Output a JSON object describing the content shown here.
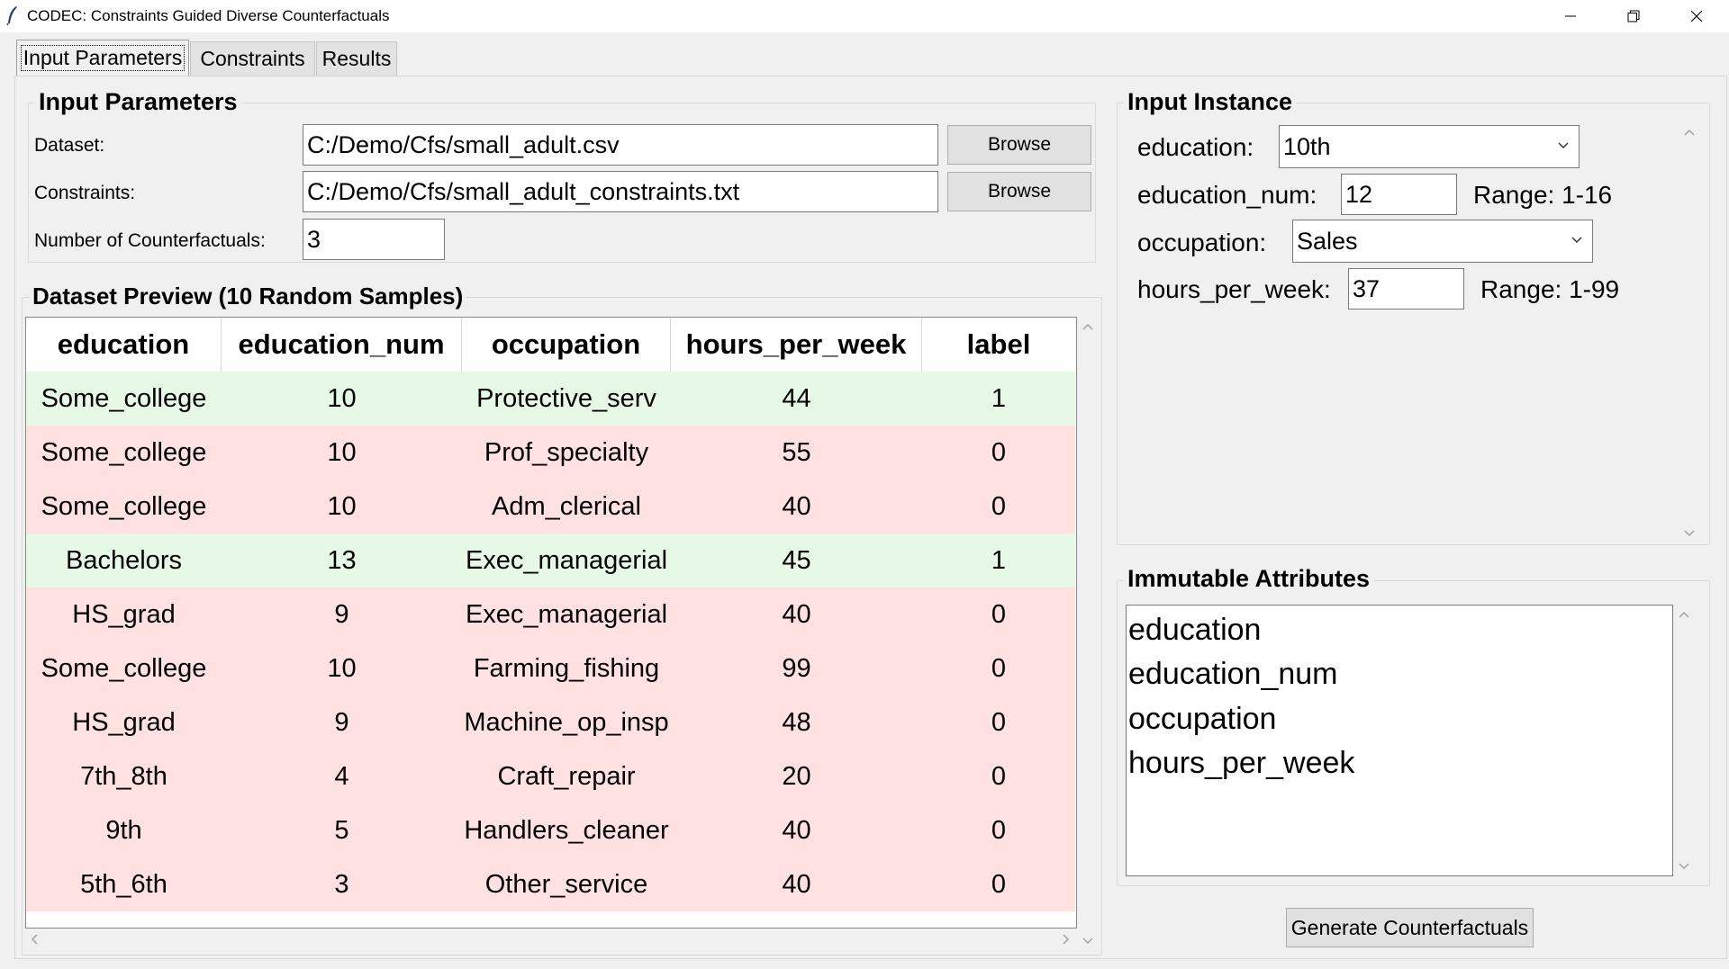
{
  "window": {
    "title": "CODEC: Constraints Guided Diverse Counterfactuals"
  },
  "tabs": [
    {
      "label": "Input Parameters"
    },
    {
      "label": "Constraints"
    },
    {
      "label": "Results"
    }
  ],
  "input_parameters": {
    "title": "Input Parameters",
    "dataset_label": "Dataset:",
    "dataset_value": "C:/Demo/Cfs/small_adult.csv",
    "constraints_label": "Constraints:",
    "constraints_value": "C:/Demo/Cfs/small_adult_constraints.txt",
    "browse_label": "Browse",
    "num_cf_label": "Number of Counterfactuals:",
    "num_cf_value": "3"
  },
  "preview": {
    "title": "Dataset Preview (10 Random Samples)",
    "columns": [
      "education",
      "education_num",
      "occupation",
      "hours_per_week",
      "label"
    ],
    "rows": [
      [
        "Some_college",
        "10",
        "Protective_serv",
        "44",
        "1"
      ],
      [
        "Some_college",
        "10",
        "Prof_specialty",
        "55",
        "0"
      ],
      [
        "Some_college",
        "10",
        "Adm_clerical",
        "40",
        "0"
      ],
      [
        "Bachelors",
        "13",
        "Exec_managerial",
        "45",
        "1"
      ],
      [
        "HS_grad",
        "9",
        "Exec_managerial",
        "40",
        "0"
      ],
      [
        "Some_college",
        "10",
        "Farming_fishing",
        "99",
        "0"
      ],
      [
        "HS_grad",
        "9",
        "Machine_op_insp",
        "48",
        "0"
      ],
      [
        "7th_8th",
        "4",
        "Craft_repair",
        "20",
        "0"
      ],
      [
        "9th",
        "5",
        "Handlers_cleaner",
        "40",
        "0"
      ],
      [
        "5th_6th",
        "3",
        "Other_service",
        "40",
        "0"
      ]
    ],
    "positive_color": "#e6f9e6",
    "negative_color": "#ffe1e1"
  },
  "instance": {
    "title": "Input Instance",
    "education_label": "education:",
    "education_value": "10th",
    "education_num_label": "education_num:",
    "education_num_value": "12",
    "education_num_range": "Range: 1-16",
    "occupation_label": "occupation:",
    "occupation_value": "Sales",
    "hours_label": "hours_per_week:",
    "hours_value": "37",
    "hours_range": "Range: 1-99"
  },
  "immutable": {
    "title": "Immutable Attributes",
    "items": [
      "education",
      "education_num",
      "occupation",
      "hours_per_week"
    ]
  },
  "generate_label": "Generate Counterfactuals"
}
